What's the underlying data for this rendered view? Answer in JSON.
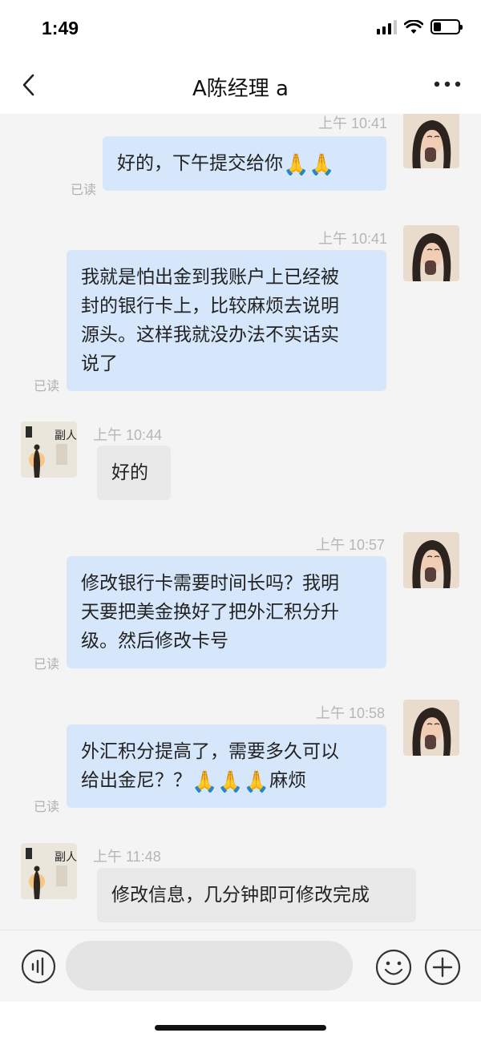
{
  "status_bar": {
    "time": "1:49"
  },
  "header": {
    "title": "A陈经理 a"
  },
  "messages": [
    {
      "timestamp": "上午 10:41",
      "direction": "out",
      "lines": [
        "好的，下午提交给你"
      ],
      "emoji_suffix": "🙏🙏",
      "read": "已读"
    },
    {
      "timestamp": "上午 10:41",
      "direction": "out",
      "lines": [
        "我就是怕出金到我账户上已经被",
        "封的银行卡上，比较麻烦去说明",
        "源头。这样我就没办法不实话实",
        "说了"
      ],
      "read": "已读"
    },
    {
      "timestamp": "上午 10:44",
      "direction": "in",
      "lines": [
        "好的"
      ]
    },
    {
      "timestamp": "上午 10:57",
      "direction": "out",
      "lines": [
        "修改银行卡需要时间长吗？我明",
        "天要把美金换好了把外汇积分升",
        "级。然后修改卡号"
      ],
      "read": "已读"
    },
    {
      "timestamp": "上午 10:58",
      "direction": "out",
      "lines": [
        "外汇积分提高了，需要多久可以",
        "给出金尼？？"
      ],
      "emoji_suffix": "🙏🙏🙏",
      "text_suffix": "麻烦",
      "read": "已读"
    },
    {
      "timestamp": "上午 11:48",
      "direction": "in",
      "lines": [
        "修改信息，几分钟即可修改完成"
      ]
    }
  ],
  "icons": {
    "back": "chevron-left-icon",
    "more": "more-dots-icon",
    "voice": "voice-icon",
    "emoji": "emoji-icon",
    "plus": "plus-icon"
  },
  "input": {
    "value": "",
    "placeholder": ""
  },
  "colors": {
    "bubble_out": "#d6e7fb",
    "bubble_in": "#e9e9e9",
    "background": "#f4f4f4",
    "meta_text": "#b6b6b6"
  }
}
